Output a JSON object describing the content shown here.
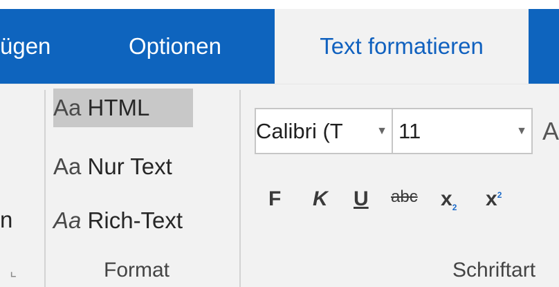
{
  "tabs": {
    "partial": "ügen",
    "options": "Optionen",
    "format_text": "Text formatieren"
  },
  "format_group": {
    "items": [
      {
        "icon_text": "Aa",
        "label": "HTML"
      },
      {
        "icon_text": "Aa",
        "label": "Nur Text"
      },
      {
        "icon_text": "Aa",
        "label": "Rich-Text"
      }
    ],
    "label": "Format",
    "selected": "HTML"
  },
  "left_group": {
    "partial_text": "n",
    "launcher": "⌞"
  },
  "font_group": {
    "font_name": "Calibri (T",
    "font_size": "11",
    "partial_glyph": "A",
    "buttons": {
      "bold": "F",
      "italic": "K",
      "underline": "U",
      "strike": "abc",
      "sub": "x",
      "sup": "x"
    },
    "label": "Schriftart"
  },
  "colors": {
    "tab_bar": "#0e64be",
    "active_tab_text": "#1061bf",
    "ribbon_bg": "#f2f2f2",
    "selected_bg": "#c8c8c8"
  }
}
